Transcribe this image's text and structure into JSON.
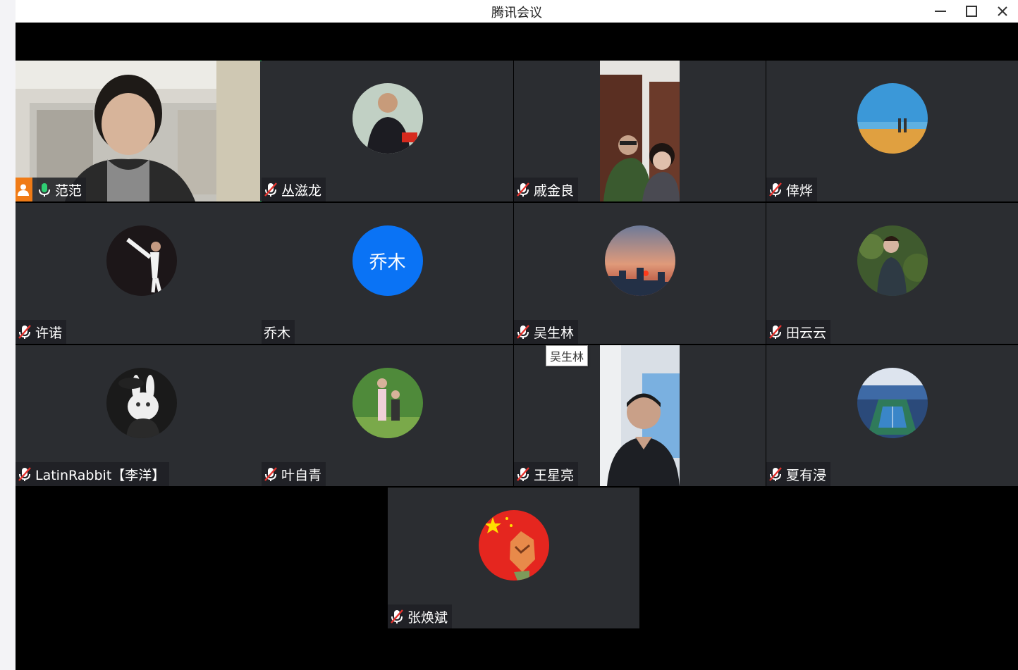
{
  "window": {
    "title": "腾讯会议"
  },
  "tooltip": "吴生林",
  "participants": [
    {
      "name": "范范",
      "kind": "video",
      "host": true,
      "mic": "on"
    },
    {
      "name": "丛滋龙",
      "kind": "avatar",
      "mic": "muted",
      "avatar": "photo-man-shouting"
    },
    {
      "name": "戚金良",
      "kind": "video",
      "mic": "muted"
    },
    {
      "name": "倖烨",
      "kind": "avatar",
      "mic": "muted",
      "avatar": "photo-beach-couple"
    },
    {
      "name": "许诺",
      "kind": "avatar",
      "mic": "muted",
      "avatar": "photo-taekwondo"
    },
    {
      "name": "乔木",
      "kind": "text-avatar",
      "initials": "乔木",
      "mic": "none"
    },
    {
      "name": "吴生林",
      "kind": "avatar",
      "mic": "muted",
      "avatar": "photo-sunset-city"
    },
    {
      "name": "田云云",
      "kind": "avatar",
      "mic": "muted",
      "avatar": "photo-woman-garden"
    },
    {
      "name": "LatinRabbit【李洋】",
      "kind": "avatar",
      "mic": "muted",
      "avatar": "photo-rabbit-gentleman"
    },
    {
      "name": "叶自青",
      "kind": "avatar",
      "mic": "muted",
      "avatar": "photo-kids-park"
    },
    {
      "name": "王星亮",
      "kind": "video",
      "mic": "muted"
    },
    {
      "name": "夏有浸",
      "kind": "avatar",
      "mic": "muted",
      "avatar": "photo-tennis-court"
    },
    {
      "name": "张焕斌",
      "kind": "avatar",
      "mic": "muted",
      "avatar": "photo-fox-flag"
    }
  ],
  "colors": {
    "tile_bg": "#2b2d31",
    "active_border": "#2fcf73",
    "host_badge": "#f07b16",
    "text_avatar_bg": "#0a73f5"
  }
}
